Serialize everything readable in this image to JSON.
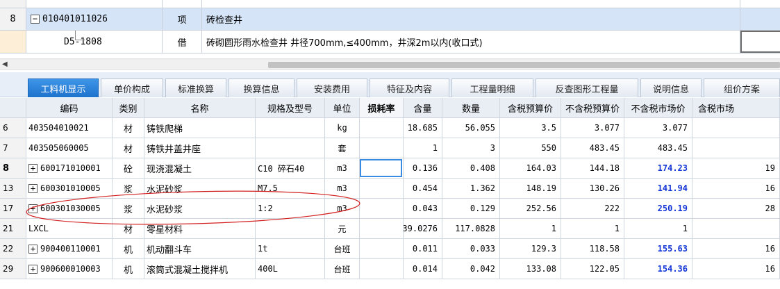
{
  "top_grid": {
    "row8": {
      "index": "8",
      "collapse_symbol": "−",
      "code": "010401011026",
      "type": "项",
      "name": "砖检查井"
    },
    "row_sub": {
      "code": "D5-1808",
      "type": "借",
      "name": "砖砌圆形雨水检查井 井径700mm,≤400mm，井深2m以内(收口式)"
    }
  },
  "tabs": [
    "工料机显示",
    "单价构成",
    "标准换算",
    "换算信息",
    "安装费用",
    "特征及内容",
    "工程量明细",
    "反查图形工程量",
    "说明信息",
    "组价方案"
  ],
  "table": {
    "headers": {
      "code": "编码",
      "category": "类别",
      "name": "名称",
      "spec": "规格及型号",
      "unit": "单位",
      "loss_rate": "损耗率",
      "content": "含量",
      "quantity": "数量",
      "tax_budget_price": "含税预算价",
      "notax_budget_price": "不含税预算价",
      "notax_market_price": "不含税市场价",
      "tax_market_price": "含税市场"
    },
    "rows": [
      {
        "rownum": "6",
        "expand": "",
        "code": "403504010021",
        "category": "材",
        "name": "铸铁爬梯",
        "spec": "",
        "unit": "kg",
        "content": "18.685",
        "quantity": "56.055",
        "tax_budget": "3.5",
        "notax_budget": "3.077",
        "notax_market": "3.077",
        "tax_market": ""
      },
      {
        "rownum": "7",
        "expand": "",
        "code": "403505060005",
        "category": "材",
        "name": "铸铁井盖井座",
        "spec": "",
        "unit": "套",
        "content": "1",
        "quantity": "3",
        "tax_budget": "550",
        "notax_budget": "483.45",
        "notax_market": "483.45",
        "tax_market": ""
      },
      {
        "rownum": "8",
        "expand": "+",
        "code": "600171010001",
        "category": "砼",
        "name": "现浇混凝土",
        "spec": "C10 碎石40",
        "unit": "m3",
        "content": "0.136",
        "quantity": "0.408",
        "tax_budget": "164.03",
        "notax_budget": "144.18",
        "notax_market": "174.23",
        "tax_market": "19"
      },
      {
        "rownum": "13",
        "expand": "+",
        "code": "600301010005",
        "category": "浆",
        "name": "水泥砂浆",
        "spec": "M7.5",
        "unit": "m3",
        "content": "0.454",
        "quantity": "1.362",
        "tax_budget": "148.19",
        "notax_budget": "130.26",
        "notax_market": "141.94",
        "tax_market": "16"
      },
      {
        "rownum": "17",
        "expand": "+",
        "code": "600301030005",
        "category": "浆",
        "name": "水泥砂浆",
        "spec": "1:2",
        "unit": "m3",
        "content": "0.043",
        "quantity": "0.129",
        "tax_budget": "252.56",
        "notax_budget": "222",
        "notax_market": "250.19",
        "tax_market": "28"
      },
      {
        "rownum": "21",
        "expand": "",
        "code": "LXCL",
        "category": "材",
        "name": "零星材料",
        "spec": "",
        "unit": "元",
        "content": "39.0276",
        "quantity": "117.0828",
        "tax_budget": "1",
        "notax_budget": "1",
        "notax_market": "1",
        "tax_market": ""
      },
      {
        "rownum": "22",
        "expand": "+",
        "code": "900400110001",
        "category": "机",
        "name": "机动翻斗车",
        "spec": "1t",
        "unit": "台班",
        "content": "0.011",
        "quantity": "0.033",
        "tax_budget": "129.3",
        "notax_budget": "118.58",
        "notax_market": "155.63",
        "tax_market": "16"
      },
      {
        "rownum": "29",
        "expand": "+",
        "code": "900600010003",
        "category": "机",
        "name": "滚筒式混凝土搅拌机",
        "spec": "400L",
        "unit": "台班",
        "content": "0.014",
        "quantity": "0.042",
        "tax_budget": "133.08",
        "notax_budget": "122.05",
        "notax_market": "154.36",
        "tax_market": "16"
      }
    ]
  },
  "colors": {
    "selected_row": "#d5e4f7",
    "active_tab": "#2a80d8",
    "market_price_blue": "#1436d6",
    "annotation_ellipse": "#d32020"
  }
}
